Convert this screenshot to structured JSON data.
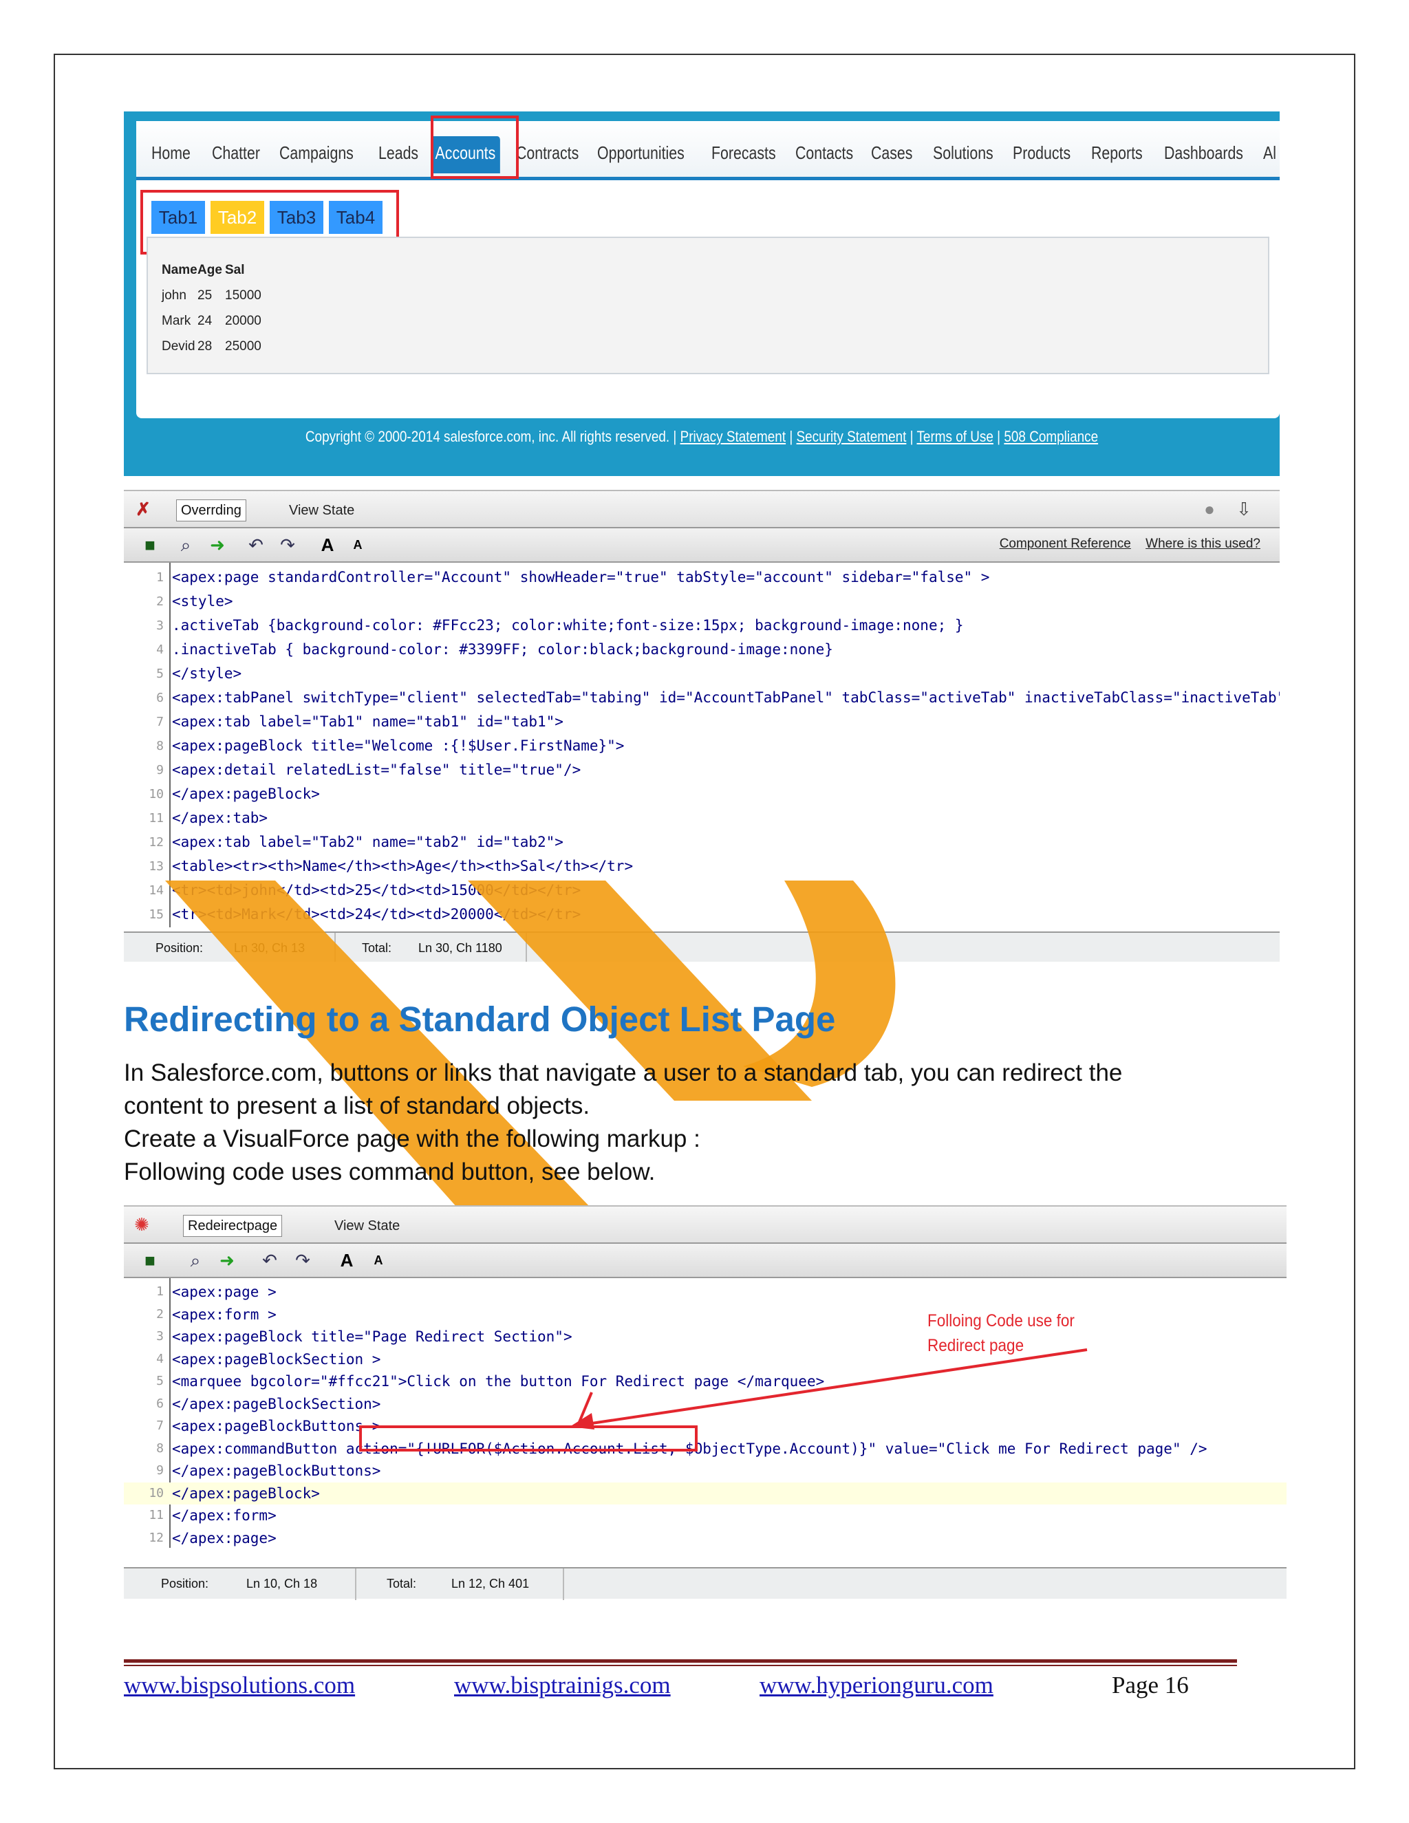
{
  "screenshot1": {
    "nav_tabs": [
      "Home",
      "Chatter",
      "Campaigns",
      "Leads",
      "Accounts",
      "Contracts",
      "Opportunities",
      "Forecasts",
      "Contacts",
      "Cases",
      "Solutions",
      "Products",
      "Reports",
      "Dashboards",
      "Al"
    ],
    "active_tab": "Accounts",
    "sub_tabs": [
      "Tab1",
      "Tab2",
      "Tab3",
      "Tab4"
    ],
    "active_sub_tab": "Tab2",
    "table": {
      "headers": [
        "Name",
        "Age",
        "Sal"
      ],
      "rows": [
        [
          "john",
          "25",
          "15000"
        ],
        [
          "Mark",
          "24",
          "20000"
        ],
        [
          "Devid",
          "28",
          "25000"
        ]
      ]
    },
    "footer_text": "Copyright © 2000-2014 salesforce.com, inc. All rights reserved. |",
    "footer_links": [
      "Privacy Statement",
      "Security Statement",
      "Terms of Use",
      "508 Compliance"
    ],
    "editor": {
      "file_tab": "Overrding",
      "view_state": "View State",
      "links": [
        "Component Reference",
        "Where is this used?"
      ],
      "lines": [
        "<apex:page standardController=\"Account\" showHeader=\"true\" tabStyle=\"account\" sidebar=\"false\" >",
        "<style>",
        ".activeTab {background-color: #FFcc23; color:white;font-size:15px; background-image:none; }",
        ".inactiveTab { background-color: #3399FF; color:black;background-image:none}",
        "</style>",
        "<apex:tabPanel switchType=\"client\" selectedTab=\"tabing\" id=\"AccountTabPanel\" tabClass=\"activeTab\" inactiveTabClass=\"inactiveTab\">",
        "<apex:tab label=\"Tab1\" name=\"tab1\" id=\"tab1\">",
        "<apex:pageBlock title=\"Welcome :{!$User.FirstName}\">",
        "<apex:detail relatedList=\"false\" title=\"true\"/>",
        "</apex:pageBlock>",
        "</apex:tab>",
        "<apex:tab label=\"Tab2\" name=\"tab2\" id=\"tab2\">",
        "<table><tr><th>Name</th><th>Age</th><th>Sal</th></tr>",
        "<tr><td>john</td><td>25</td><td>15000</td></tr>",
        "<tr><td>Mark</td><td>24</td><td>20000</td></tr>"
      ],
      "status": {
        "position_label": "Position:",
        "position": "Ln 30, Ch 13",
        "total_label": "Total:",
        "total": "Ln 30, Ch 1180"
      }
    }
  },
  "heading": "Redirecting to a Standard Object List Page",
  "paragraphs": [
    "In Salesforce.com, buttons or links that navigate a user to a standard tab, you can redirect the",
    "content to present a list of standard objects.",
    "Create a VisualForce page with the following markup :",
    "Following  code uses command button, see below."
  ],
  "screenshot2": {
    "editor": {
      "file_tab": "Redeirectpage",
      "view_state": "View State",
      "lines": [
        "<apex:page >",
        "<apex:form >",
        "<apex:pageBlock title=\"Page Redirect Section\">",
        "<apex:pageBlockSection >",
        "<marquee bgcolor=\"#ffcc21\">Click on the button For Redirect page </marquee>",
        "</apex:pageBlockSection>",
        "<apex:pageBlockButtons >",
        "<apex:commandButton action=\"{!URLFOR($Action.Account.List, $ObjectType.Account)}\" value=\"Click me For Redirect page\" />",
        "</apex:pageBlockButtons>",
        "</apex:pageBlock>",
        "</apex:form>",
        "</apex:page>"
      ],
      "status": {
        "position_label": "Position:",
        "position": "Ln 10, Ch 18",
        "total_label": "Total:",
        "total": "Ln 12, Ch 401"
      }
    },
    "annotation": [
      "Folloing Code use for",
      "Redirect page"
    ]
  },
  "footer": {
    "links": [
      "www.bispsolutions.com",
      "www.bisptrainigs.com",
      "www.hyperionguru.com"
    ],
    "page": "Page 16"
  },
  "colors": {
    "accent_blue": "#1f74c3",
    "salesforce_blue": "#1e9ac7",
    "tab_yellow": "#ffcc23",
    "tab_blue": "#3399ff",
    "highlight_red": "#e3262e",
    "watermark_orange": "#f39c12"
  }
}
